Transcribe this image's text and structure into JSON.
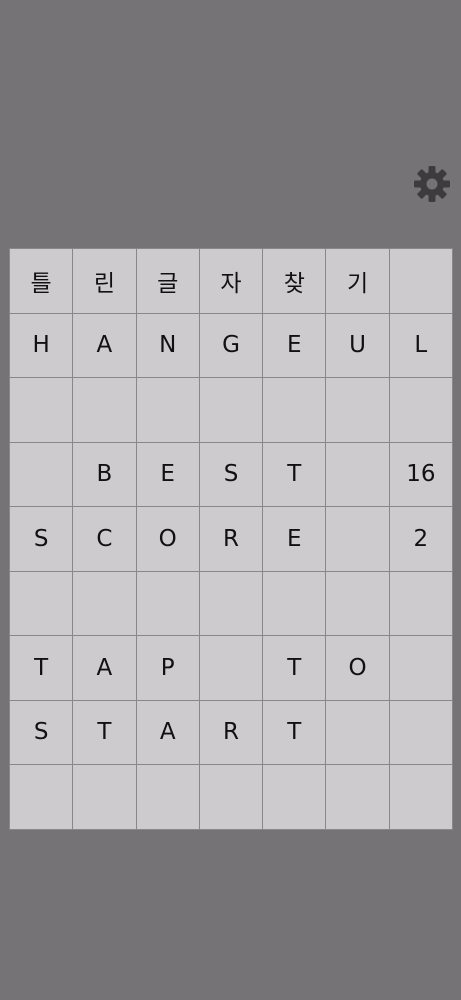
{
  "settings": {
    "icon": "gear-icon"
  },
  "board": {
    "rows": [
      [
        "틀",
        "린",
        "글",
        "자",
        "찾",
        "기",
        ""
      ],
      [
        "H",
        "A",
        "N",
        "G",
        "E",
        "U",
        "L"
      ],
      [
        "",
        "",
        "",
        "",
        "",
        "",
        ""
      ],
      [
        "",
        "B",
        "E",
        "S",
        "T",
        "",
        "16"
      ],
      [
        "S",
        "C",
        "O",
        "R",
        "E",
        "",
        "2"
      ],
      [
        "",
        "",
        "",
        "",
        "",
        "",
        ""
      ],
      [
        "T",
        "A",
        "P",
        "",
        "T",
        "O",
        ""
      ],
      [
        "S",
        "T",
        "A",
        "R",
        "T",
        "",
        ""
      ],
      [
        "",
        "",
        "",
        "",
        "",
        "",
        ""
      ]
    ]
  },
  "colors": {
    "background": "#757375",
    "cell": "#cdcbce",
    "grid_line": "#8a878a",
    "icon": "#3d3b3d"
  }
}
